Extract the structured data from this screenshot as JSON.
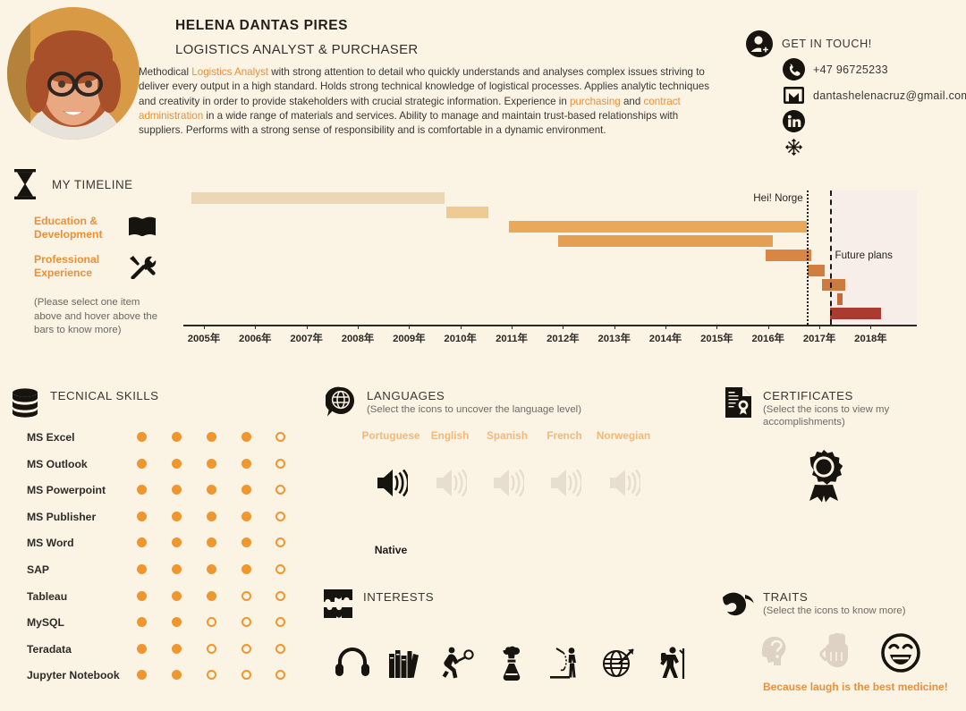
{
  "header": {
    "name": "HELENA DANTAS PIRES",
    "job_title": "LOGISTICS ANALYST & PURCHASER",
    "bio_parts": [
      {
        "t": "Methodical ",
        "hl": false
      },
      {
        "t": "Logistics Analyst",
        "hl": true
      },
      {
        "t": " with strong attention to detail who quickly understands and analyses complex issues striving to deliver every output in a high standard. Holds strong technical knowledge of logistical processes. Applies analytic techniques and creativity in order to provide stakeholders with crucial strategic information. Experience in ",
        "hl": false
      },
      {
        "t": "purchasing",
        "hl": true
      },
      {
        "t": " and ",
        "hl": false
      },
      {
        "t": "contract administration",
        "hl": true
      },
      {
        "t": " in a wide range of materials and services. Ability to manage and maintain trust-based relationships with suppliers. Performs with a strong sense of responsibility and is comfortable in a dynamic environment.",
        "hl": false
      }
    ]
  },
  "contact": {
    "title": "GET IN TOUCH!",
    "phone": "+47 96725233",
    "email": "dantashelenacruz@gmail.com",
    "icons": [
      "user-add-icon",
      "phone-icon",
      "email-icon",
      "linkedin-icon",
      "snowflake-icon"
    ]
  },
  "timeline": {
    "title": "MY TIMELINE",
    "legend": [
      {
        "label": "Education & Development",
        "icon": "book-icon"
      },
      {
        "label": "Professional Experience",
        "icon": "tools-icon"
      }
    ],
    "note": "(Please select one item above and hover above the bars to know more)",
    "annotations": [
      {
        "label": "Hei! Norge",
        "year": 2016.75,
        "style": "dotted"
      },
      {
        "label": "Future plans",
        "year": 2017.2,
        "style": "dashed"
      }
    ]
  },
  "chart_data": {
    "type": "bar",
    "chart_subtype": "gantt",
    "title": "MY TIMELINE",
    "xlabel": "",
    "ylabel": "",
    "xlim": [
      2004.6,
      2018.9
    ],
    "x_tick_labels": [
      "2005年",
      "2006年",
      "2007年",
      "2008年",
      "2009年",
      "2010年",
      "2011年",
      "2012年",
      "2013年",
      "2014年",
      "2015年",
      "2016年",
      "2017年",
      "2018年"
    ],
    "x_tick_values": [
      2005,
      2006,
      2007,
      2008,
      2009,
      2010,
      2011,
      2012,
      2013,
      2014,
      2015,
      2016,
      2017,
      2018
    ],
    "grid": false,
    "legend_position": "left",
    "future_zone": {
      "start": 2017.2,
      "end": 2018.9,
      "color": "#f7eeea"
    },
    "bars": [
      {
        "row": 0,
        "start": 2004.75,
        "end": 2009.7,
        "color": "#ebd7b5"
      },
      {
        "row": 1,
        "start": 2009.72,
        "end": 2010.55,
        "color": "#eecb95"
      },
      {
        "row": 2,
        "start": 2010.95,
        "end": 2016.75,
        "color": "#eaa85b"
      },
      {
        "row": 3,
        "start": 2011.9,
        "end": 2016.1,
        "color": "#e49f52"
      },
      {
        "row": 4,
        "start": 2015.95,
        "end": 2016.85,
        "color": "#d98544"
      },
      {
        "row": 5,
        "start": 2016.77,
        "end": 2017.1,
        "color": "#d07f43"
      },
      {
        "row": 6,
        "start": 2017.05,
        "end": 2017.5,
        "color": "#cb7a41"
      },
      {
        "row": 7,
        "start": 2017.35,
        "end": 2017.45,
        "color": "#c56b3a"
      },
      {
        "row": 8,
        "start": 2017.2,
        "end": 2018.2,
        "color": "#ab3b30"
      }
    ]
  },
  "skills": {
    "title": "TECNICAL SKILLS",
    "icon": "database-icon",
    "max_level": 5,
    "items": [
      {
        "name": "MS Excel",
        "level": 4
      },
      {
        "name": "MS Outlook",
        "level": 4
      },
      {
        "name": "MS Powerpoint",
        "level": 4
      },
      {
        "name": "MS Publisher",
        "level": 4
      },
      {
        "name": "MS Word",
        "level": 4
      },
      {
        "name": "SAP",
        "level": 4
      },
      {
        "name": "Tableau",
        "level": 3
      },
      {
        "name": "MySQL",
        "level": 2
      },
      {
        "name": "Teradata",
        "level": 2
      },
      {
        "name": "Jupyter Notebook",
        "level": 2
      }
    ]
  },
  "languages": {
    "title": "LANGUAGES",
    "subtitle": "(Select the icons to uncover the language level)",
    "icon": "globe-speech-icon",
    "items": [
      {
        "name": "Portuguese",
        "selected": true,
        "level": "Native"
      },
      {
        "name": "English",
        "selected": false,
        "level": ""
      },
      {
        "name": "Spanish",
        "selected": false,
        "level": ""
      },
      {
        "name": "French",
        "selected": false,
        "level": ""
      },
      {
        "name": "Norwegian",
        "selected": false,
        "level": ""
      }
    ]
  },
  "certificates": {
    "title": "CERTIFICATES",
    "subtitle": "(Select the icons to view my accomplishments)",
    "icon": "certificate-doc-icon",
    "items": [
      {
        "icon": "award-ribbon-icon",
        "selected": true
      }
    ]
  },
  "interests": {
    "title": "INTERESTS",
    "icon": "puzzle-icon",
    "items": [
      {
        "icon": "headphones-icon"
      },
      {
        "icon": "books-icon"
      },
      {
        "icon": "sports-ball-icon"
      },
      {
        "icon": "cooking-icon"
      },
      {
        "icon": "fishing-icon"
      },
      {
        "icon": "travel-globe-icon"
      },
      {
        "icon": "hiking-icon"
      }
    ]
  },
  "traits": {
    "title": "TRAITS",
    "subtitle": "(Select the icons to know more)",
    "icon": "muscle-arm-icon",
    "items": [
      {
        "icon": "curious-head-icon",
        "selected": false
      },
      {
        "icon": "hands-on-gloves-icon",
        "selected": false
      },
      {
        "icon": "smiley-laugh-icon",
        "selected": true
      }
    ],
    "caption": "Because laugh is the best medicine!"
  },
  "colors": {
    "background": "#fbf3e4",
    "accent_orange": "#e8913c",
    "dot_orange": "#f0962e",
    "dark": "#231f1c",
    "muted": "#6f6b64",
    "future_zone": "#f7eeea"
  }
}
